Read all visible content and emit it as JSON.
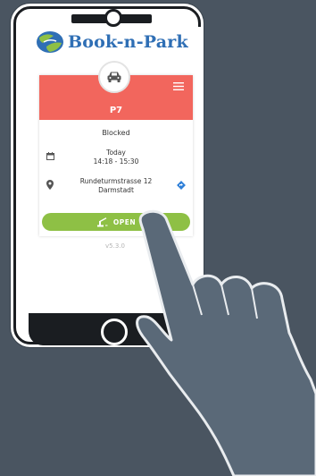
{
  "app": {
    "brand_name": "Book-n-Park",
    "version": "v5.3.0"
  },
  "spot": {
    "id": "P7",
    "status": "Blocked"
  },
  "booking": {
    "day": "Today",
    "time": "14:18 - 15:30"
  },
  "location": {
    "street": "Rundeturmstrasse 12",
    "city": "Darmstadt"
  },
  "actions": {
    "open_label": "OPEN"
  },
  "colors": {
    "header": "#f2665d",
    "open_button": "#8ec045",
    "brand": "#2f6fb5",
    "background": "#4a5561"
  },
  "icons": [
    "car-icon",
    "menu-icon",
    "calendar-icon",
    "location-pin-icon",
    "navigation-icon",
    "barrier-icon",
    "pointing-hand"
  ]
}
